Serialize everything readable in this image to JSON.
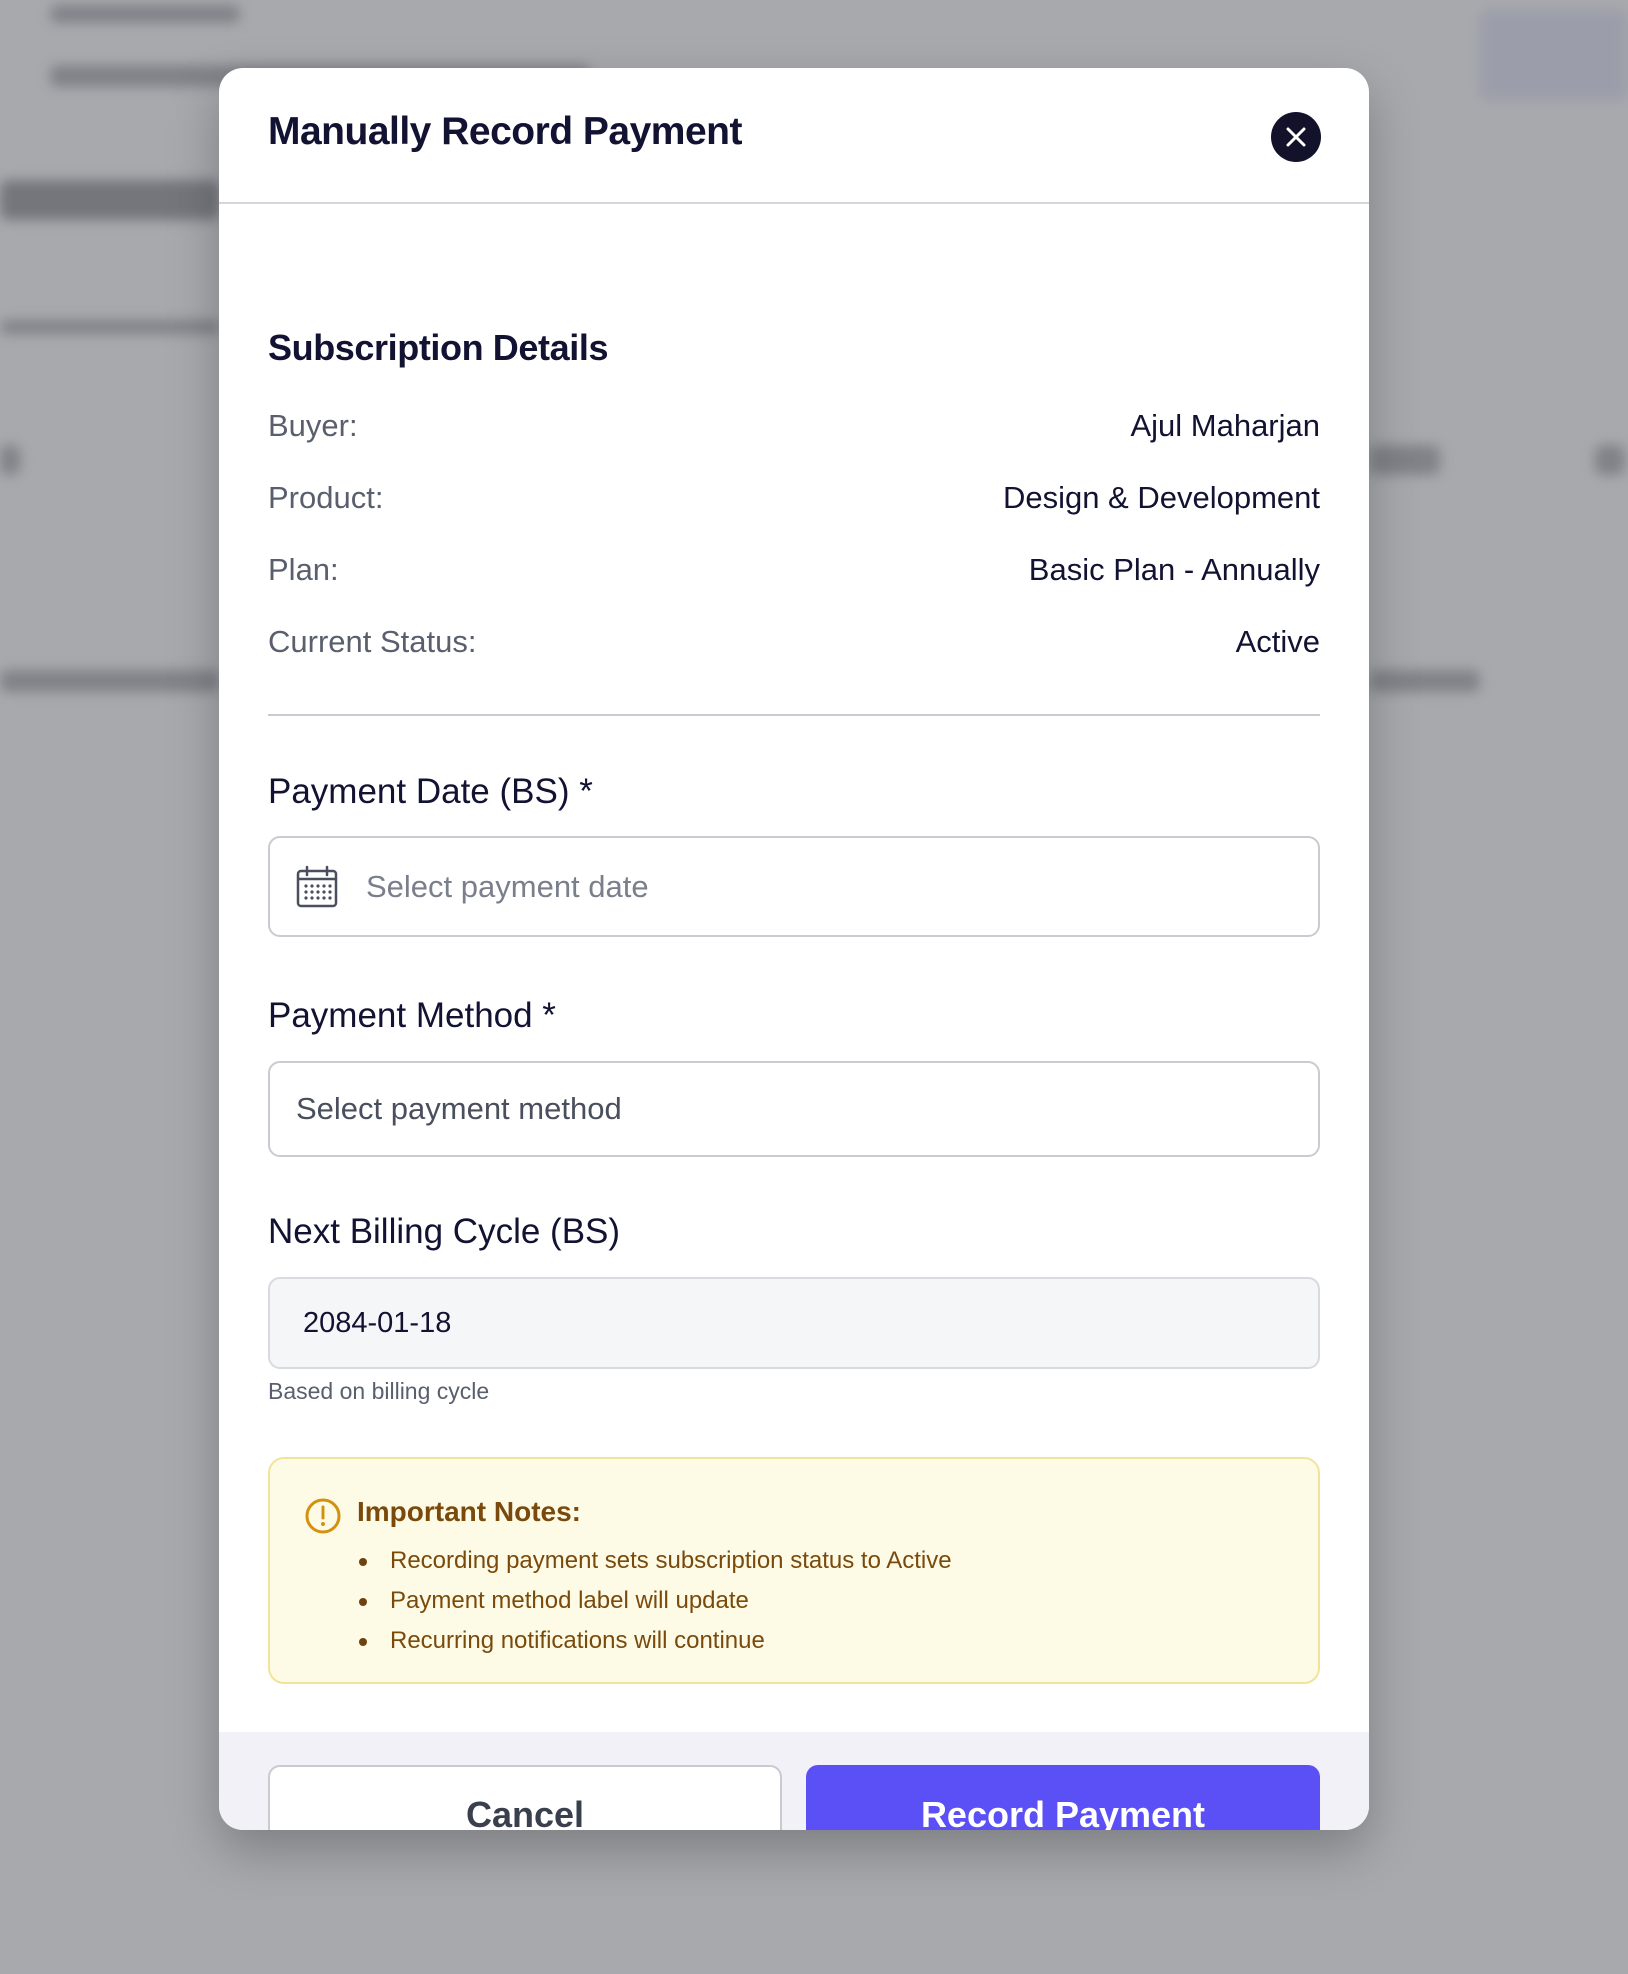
{
  "modal": {
    "title": "Manually Record Payment",
    "close_icon": "close-icon"
  },
  "subscription": {
    "section_title": "Subscription Details",
    "rows": [
      {
        "label": "Buyer:",
        "value": "Ajul Maharjan"
      },
      {
        "label": "Product:",
        "value": "Design & Development"
      },
      {
        "label": "Plan:",
        "value": "Basic Plan - Annually"
      },
      {
        "label": "Current Status:",
        "value": "Active"
      }
    ]
  },
  "form": {
    "payment_date": {
      "label": "Payment Date (BS) *",
      "placeholder": "Select payment date",
      "icon": "calendar-icon"
    },
    "payment_method": {
      "label": "Payment Method *",
      "placeholder": "Select payment method"
    },
    "next_billing": {
      "label": "Next Billing Cycle (BS)",
      "value": "2084-01-18",
      "help": "Based on billing cycle"
    }
  },
  "notes": {
    "icon": "alert-circle-icon",
    "title": "Important Notes:",
    "items": [
      "Recording payment sets subscription status to Active",
      "Payment method label will update",
      "Recurring notifications will continue"
    ]
  },
  "footer": {
    "cancel_label": "Cancel",
    "submit_label": "Record Payment"
  },
  "colors": {
    "primary": "#5b50f5",
    "notes_bg": "#fdfbe6",
    "notes_text": "#7a4a0c",
    "heading": "#121233"
  }
}
